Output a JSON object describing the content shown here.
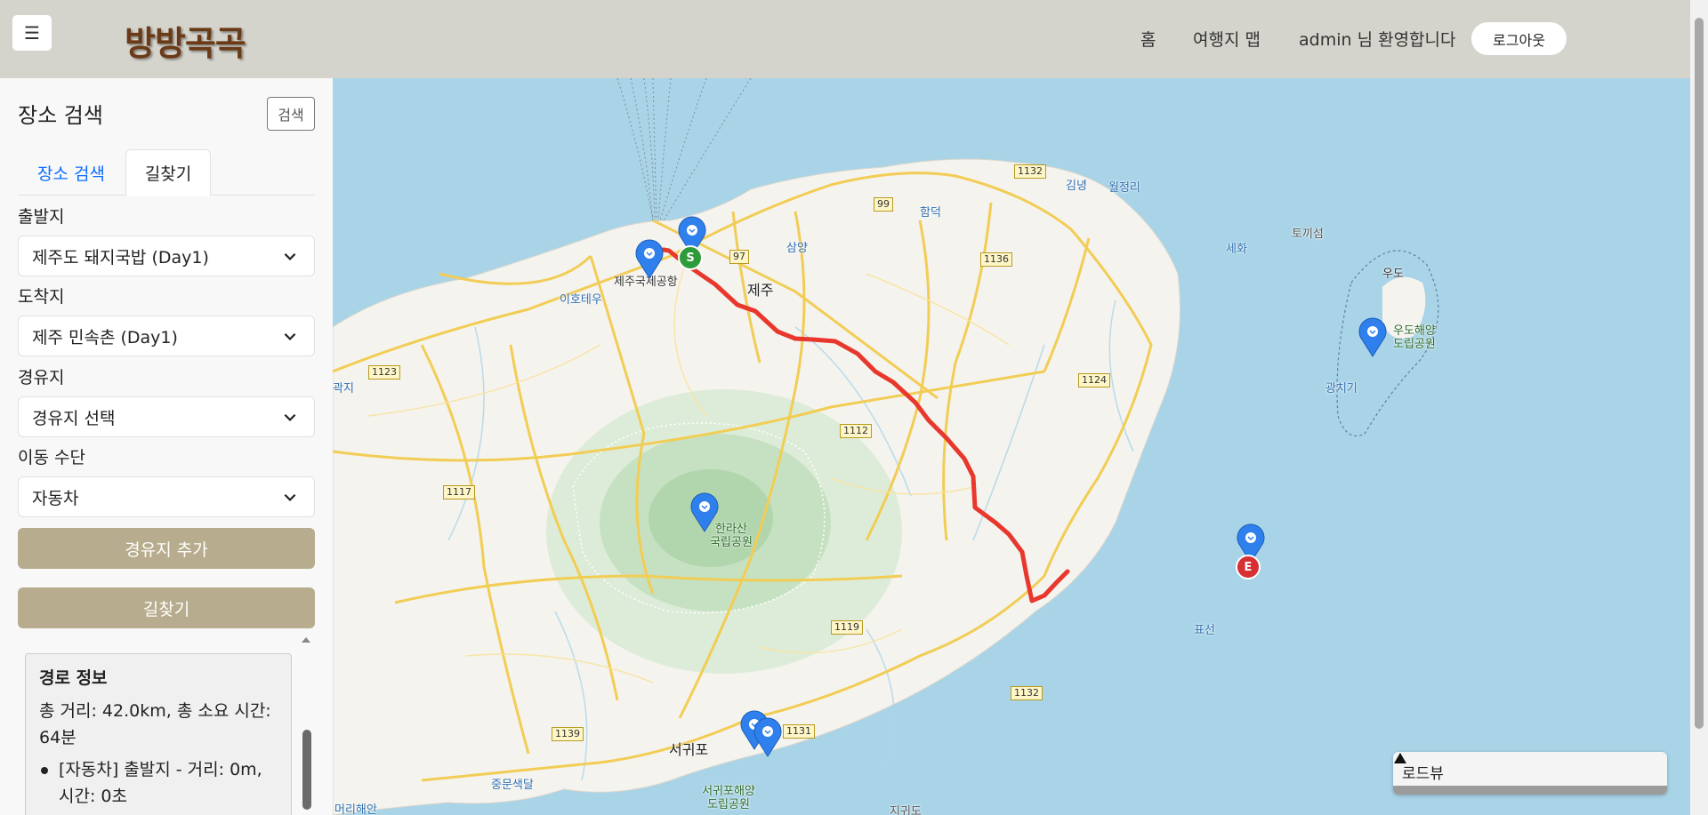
{
  "header": {
    "menu_icon": "hamburger-icon",
    "logo": "방방곡곡",
    "nav_home": "홈",
    "nav_map": "여행지 맵",
    "welcome": "admin 님 환영합니다",
    "logout": "로그아웃"
  },
  "sidebar": {
    "title": "장소 검색",
    "search_button": "검색",
    "tabs": [
      {
        "label": "장소 검색",
        "active": false
      },
      {
        "label": "길찾기",
        "active": true
      }
    ],
    "departure": {
      "label": "출발지",
      "value": "제주도 돼지국밥 (Day1)"
    },
    "arrival": {
      "label": "도착지",
      "value": "제주 민속촌 (Day1)"
    },
    "waypoint": {
      "label": "경유지",
      "value": "경유지 선택"
    },
    "transport": {
      "label": "이동 수단",
      "value": "자동차"
    },
    "add_waypoint_button": "경유지 추가",
    "route_button": "길찾기",
    "route_info": {
      "title": "경로 정보",
      "summary": "총 거리: 42.0km, 총 소요 시간: 64분",
      "steps": [
        "[자동차] 출발지 - 거리: 0m, 시간: 0초"
      ]
    }
  },
  "map": {
    "places": {
      "jeju": "제주",
      "airport": "제주국제공항",
      "ihotewoo": "이호테우",
      "samyang": "삼양",
      "hamdeok": "함덕",
      "gimnyeong": "김녕",
      "woljeongri": "월정리",
      "sehwa": "세화",
      "tokkiseom": "토끼섬",
      "udo": "우도",
      "udo_park": "우도해양\n도립공원",
      "gwangchigi": "광치기",
      "pyoseon": "표선",
      "hallasan": "한라산\n국립공원",
      "seogwipo": "서귀포",
      "seogwipo_park": "서귀포해양\n도립공원",
      "jungmun": "중문색달",
      "gwakji": "곽지",
      "jigwido": "지귀도",
      "nanmeori": "머리해안"
    },
    "roads": [
      "1132",
      "99",
      "1136",
      "1123",
      "1124",
      "1112",
      "1117",
      "1119",
      "1131",
      "1139",
      "97"
    ],
    "start_marker": "S",
    "end_marker": "E",
    "route_color": "#e8372d",
    "roadview": {
      "label": "로드뷰",
      "icon": "triangle-up-icon"
    }
  },
  "colors": {
    "header_bg": "#d4d3cc",
    "logo": "#6b3b18",
    "brown_button": "#b7ac8d",
    "sea": "#a9d4e8",
    "land": "#f5f3ee",
    "pin": "#2f80ed"
  }
}
